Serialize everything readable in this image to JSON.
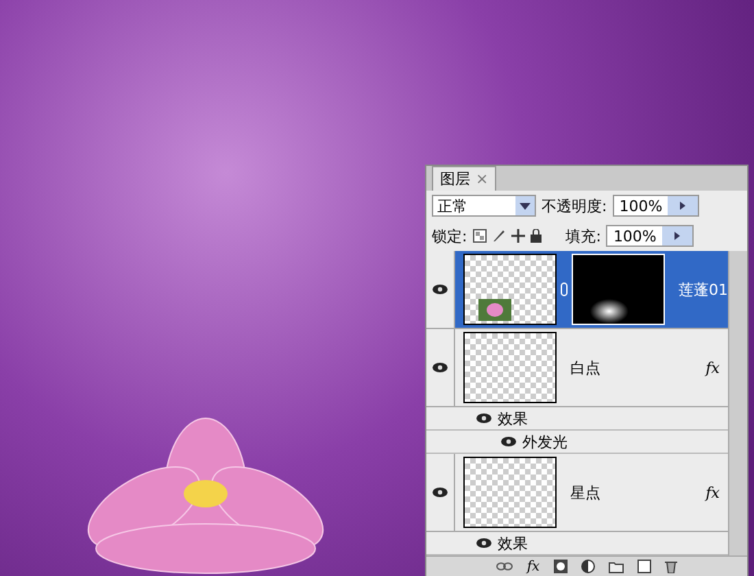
{
  "panel": {
    "tab": {
      "label": "图层",
      "close": "×",
      "selected": true
    },
    "blend_mode": "正常",
    "opacity_label": "不透明度:",
    "opacity": "100%",
    "lock_label": "锁定:",
    "fill_label": "填充:",
    "fill": "100%",
    "layers": [
      {
        "name": "莲蓬01",
        "selected": true,
        "visible": true,
        "mask": true
      },
      {
        "name": "白点",
        "selected": false,
        "visible": true,
        "mask": false,
        "fx": "fx",
        "effects": [
          {
            "name": "效果",
            "visible": true,
            "children": [
              {
                "name": "外发光",
                "visible": true
              }
            ]
          }
        ]
      },
      {
        "name": "星点",
        "selected": false,
        "visible": true,
        "mask": false,
        "fx": "fx",
        "effects": [
          {
            "name": "效果",
            "visible": true
          }
        ]
      }
    ],
    "toolbar_fx": "fx"
  }
}
